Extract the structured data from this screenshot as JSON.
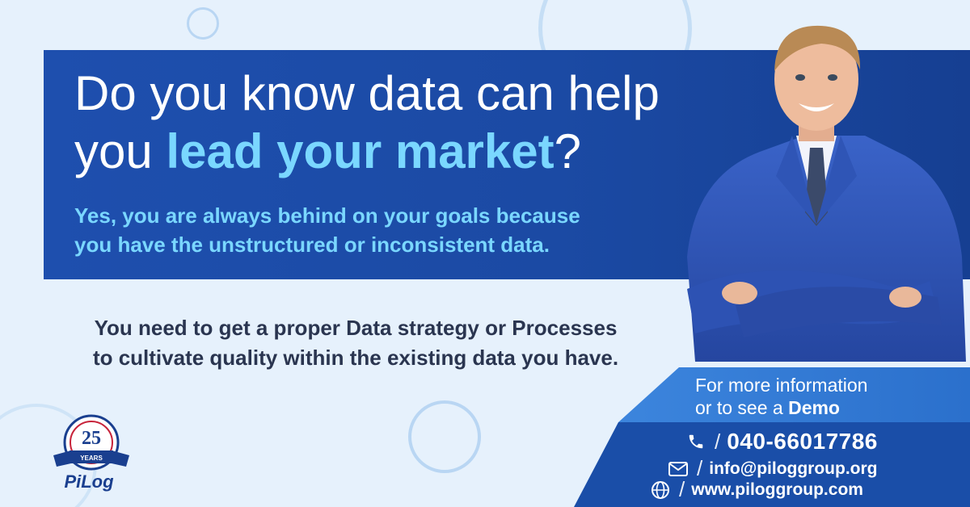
{
  "headline": {
    "line1": "Do you know data can help",
    "line2_prefix": "you ",
    "line2_accent": "lead your market",
    "line2_suffix": "?"
  },
  "subtext": {
    "line1": "Yes, you are always behind on your goals because",
    "line2": "you have the unstructured or inconsistent data."
  },
  "body_copy": {
    "line1": "You need to get a proper Data strategy or Processes",
    "line2": "to cultivate quality within the existing data you have."
  },
  "cta": {
    "line1": "For more information",
    "line2_prefix": "or to see a ",
    "line2_bold": "Demo"
  },
  "contact": {
    "phone": "040-66017786",
    "email": "info@piloggroup.org",
    "website": "www.piloggroup.com"
  },
  "logo": {
    "anniversary_number": "25",
    "anniversary_word": "YEARS",
    "brand": "PiLog"
  },
  "icons": {
    "phone": "phone-icon",
    "email": "envelope-icon",
    "web": "globe-icon"
  },
  "colors": {
    "banner": "#1e4fae",
    "accent": "#7ad7ff",
    "background": "#e6f1fc",
    "cta_band": "#3c85dd",
    "contact_panel": "#1a4ea8"
  }
}
